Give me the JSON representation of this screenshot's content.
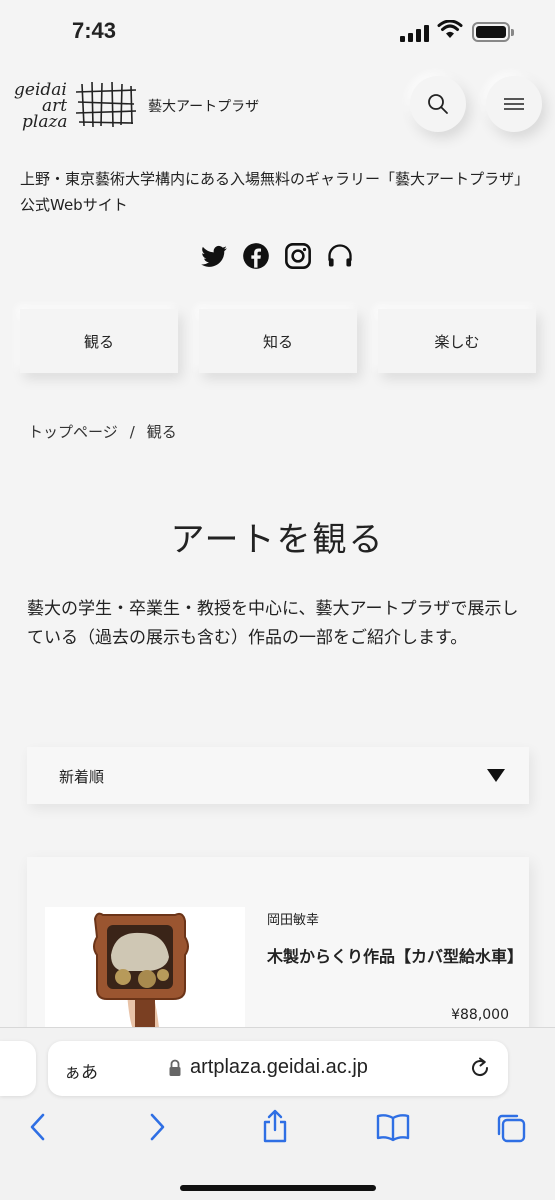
{
  "status_bar": {
    "time": "7:43"
  },
  "header": {
    "logo_words": [
      "geidai",
      "art",
      "plaza"
    ],
    "site_name": "藝大アートプラザ"
  },
  "tagline": "上野・東京藝術大学構内にある入場無料のギャラリー「藝大アートプラザ」公式Webサイト",
  "socials": [
    "twitter-icon",
    "facebook-icon",
    "instagram-icon",
    "headphones-icon"
  ],
  "nav": {
    "items": [
      "観る",
      "知る",
      "楽しむ"
    ]
  },
  "breadcrumb": {
    "home": "トップページ",
    "separator": "/",
    "current": "観る"
  },
  "page_title": "アートを観る",
  "description": "藝大の学生・卒業生・教授を中心に、藝大アートプラザで展示している（過去の展示も含む）作品の一部をご紹介します。",
  "sort": {
    "selected": "新着順"
  },
  "cards": [
    {
      "artist": "岡田敏幸",
      "title": "木製からくり作品【カバ型給水車】",
      "price": "¥88,000"
    }
  ],
  "browser": {
    "aa_label": "ぁあ",
    "url": "artplaza.geidai.ac.jp"
  },
  "colors": {
    "background": "#f4f4f4",
    "text": "#222222",
    "ios_blue": "#2f6fe4"
  }
}
